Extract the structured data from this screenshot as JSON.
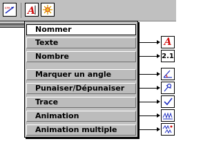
{
  "toolbar": {
    "tools": [
      {
        "icon": "compass-arrow-icon"
      },
      {
        "icon": "text-label-icon",
        "glyph": "A",
        "suffix": "|"
      },
      {
        "icon": "star-burst-icon"
      }
    ]
  },
  "menu": {
    "items": [
      {
        "label": "Nommer",
        "selected": true
      },
      {
        "label": "Texte"
      },
      {
        "label": "Nombre"
      },
      {
        "label": "Marquer un angle"
      },
      {
        "label": "Punaiser/Dépunaiser"
      },
      {
        "label": "Trace"
      },
      {
        "label": "Animation"
      },
      {
        "label": "Animation multiple"
      }
    ]
  },
  "side_tools": [
    {
      "icon": "text-a-icon",
      "glyph": "A"
    },
    {
      "icon": "number-icon",
      "glyph": "2.1"
    },
    {
      "icon": "angle-mark-icon"
    },
    {
      "icon": "pin-icon"
    },
    {
      "icon": "trace-check-icon"
    },
    {
      "icon": "animation-icon"
    },
    {
      "icon": "multi-animation-icon"
    }
  ],
  "colors": {
    "menu_bg": "#c0c0c0",
    "accent_red": "#d01010",
    "accent_blue": "#2030c0"
  }
}
